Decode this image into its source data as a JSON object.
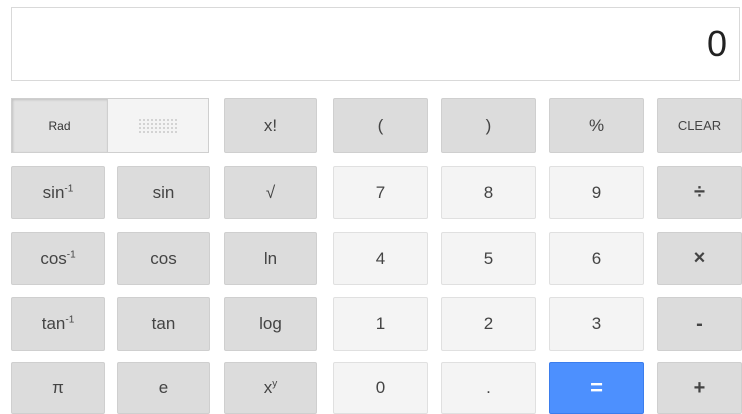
{
  "display": {
    "value": "0"
  },
  "mode": {
    "rad_label": "Rad",
    "deg_label": ""
  },
  "buttons": {
    "factorial": "x!",
    "open_paren": "(",
    "close_paren": ")",
    "percent": "%",
    "clear": "CLEAR",
    "asin_base": "sin",
    "asin_sup": "-1",
    "sin": "sin",
    "sqrt": "√",
    "d7": "7",
    "d8": "8",
    "d9": "9",
    "divide": "÷",
    "acos_base": "cos",
    "acos_sup": "-1",
    "cos": "cos",
    "ln": "ln",
    "d4": "4",
    "d5": "5",
    "d6": "6",
    "multiply": "×",
    "atan_base": "tan",
    "atan_sup": "-1",
    "tan": "tan",
    "log": "log",
    "d1": "1",
    "d2": "2",
    "d3": "3",
    "minus": "-",
    "pi": "π",
    "e": "e",
    "pow_base": "x",
    "pow_sup": "y",
    "d0": "0",
    "decimal": ".",
    "equals": "=",
    "plus": "+"
  },
  "colors": {
    "function_key": "#dcdcdc",
    "number_key": "#f4f4f4",
    "equals_key": "#4d90fe"
  }
}
